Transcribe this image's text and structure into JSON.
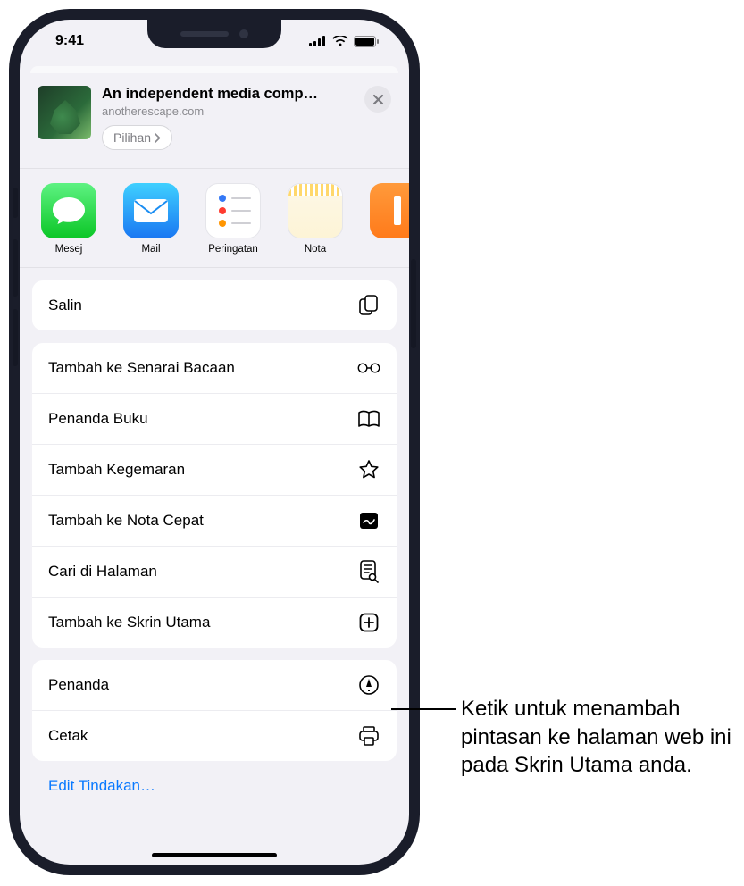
{
  "status": {
    "time": "9:41"
  },
  "header": {
    "title": "An independent media comp…",
    "subtitle": "anotherescape.com",
    "options_label": "Pilihan"
  },
  "apps": [
    {
      "id": "messages",
      "label": "Mesej"
    },
    {
      "id": "mail",
      "label": "Mail"
    },
    {
      "id": "reminders",
      "label": "Peringatan"
    },
    {
      "id": "notes",
      "label": "Nota"
    },
    {
      "id": "books",
      "label": ""
    }
  ],
  "actions": {
    "group1": [
      {
        "id": "copy",
        "label": "Salin",
        "icon": "copy-icon"
      }
    ],
    "group2": [
      {
        "id": "reading-list",
        "label": "Tambah ke Senarai Bacaan",
        "icon": "glasses-icon"
      },
      {
        "id": "bookmark",
        "label": "Penanda Buku",
        "icon": "book-icon"
      },
      {
        "id": "favorite",
        "label": "Tambah Kegemaran",
        "icon": "star-icon"
      },
      {
        "id": "quicknote",
        "label": "Tambah ke Nota Cepat",
        "icon": "quicknote-icon"
      },
      {
        "id": "find",
        "label": "Cari di Halaman",
        "icon": "find-icon"
      },
      {
        "id": "homescreen",
        "label": "Tambah ke Skrin Utama",
        "icon": "addhome-icon"
      }
    ],
    "group3": [
      {
        "id": "markup",
        "label": "Penanda",
        "icon": "markup-icon"
      },
      {
        "id": "print",
        "label": "Cetak",
        "icon": "print-icon"
      }
    ],
    "edit_label": "Edit Tindakan…"
  },
  "callout": {
    "text": "Ketik untuk menambah pintasan ke halaman web ini pada Skrin Utama anda."
  }
}
